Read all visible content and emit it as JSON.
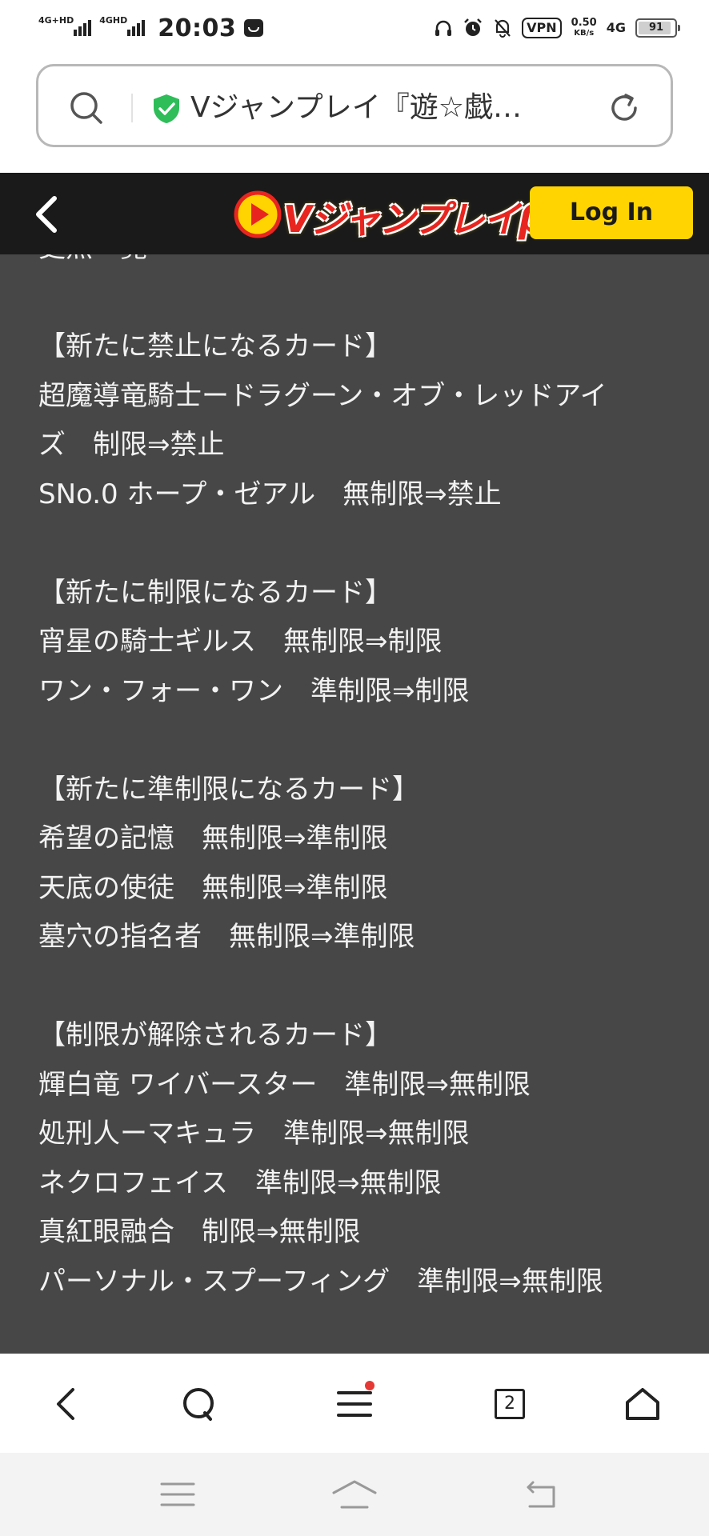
{
  "status_bar": {
    "network1_label": "4G+HD",
    "network2_label": "4GHD",
    "time": "20:03",
    "vpn_label": "VPN",
    "speed_value": "0.50",
    "speed_unit": "KB/s",
    "lte_label": "4G",
    "battery_level": "91",
    "battery_fraction": 0.91
  },
  "address_bar": {
    "page_title": "Vジャンプレイ『遊☆戯☆…",
    "secure_color": "#2ebd59"
  },
  "site_header": {
    "logo_text": "Vジャンプレイβ",
    "login_label": "Log In",
    "accent_color": "#ffd400"
  },
  "content": {
    "lines": [
      "更点一覧",
      "",
      "【新たに禁止になるカード】",
      "超魔導竜騎士ードラグーン・オブ・レッドアイ",
      "ズ　制限⇒禁止",
      "SNo.0 ホープ・ゼアル　無制限⇒禁止",
      "",
      "【新たに制限になるカード】",
      "宵星の騎士ギルス　無制限⇒制限",
      "ワン・フォー・ワン　準制限⇒制限",
      "",
      "【新たに準制限になるカード】",
      "希望の記憶　無制限⇒準制限",
      "天底の使徒　無制限⇒準制限",
      "墓穴の指名者　無制限⇒準制限",
      "",
      "【制限が解除されるカード】",
      "輝白竜 ワイバースター　準制限⇒無制限",
      "処刑人ーマキュラ　準制限⇒無制限",
      "ネクロフェイス　準制限⇒無制限",
      "真紅眼融合　制限⇒無制限",
      "パーソナル・スプーフィング　準制限⇒無制限"
    ]
  },
  "browser_bar": {
    "tab_count": "2",
    "notification_color": "#e53935"
  }
}
